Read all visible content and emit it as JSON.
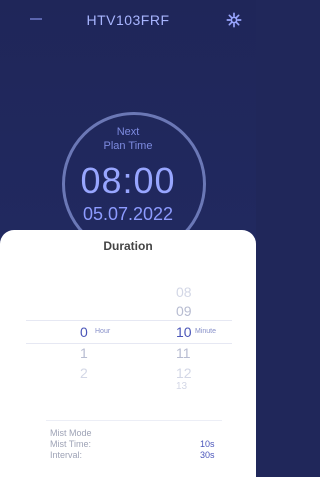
{
  "topbar": {
    "device_name": "HTV103FRF"
  },
  "plan": {
    "next_label_1": "Next",
    "next_label_2": "Plan Time",
    "time": "08:00",
    "date": "05.07.2022"
  },
  "sheet": {
    "title": "Duration",
    "hour_column": {
      "selected": "0",
      "selected_unit": "Hour",
      "below": [
        "1",
        "2"
      ]
    },
    "minute_column": {
      "above": [
        "08",
        "09"
      ],
      "selected": "10",
      "selected_unit": "Minute",
      "below": [
        "11",
        "12",
        "13"
      ]
    }
  },
  "footer": {
    "mode": "Mist Mode",
    "mist_time_label": "Mist Time:",
    "mist_time_value": "10s",
    "interval_label": "Interval:",
    "interval_value": "30s"
  }
}
